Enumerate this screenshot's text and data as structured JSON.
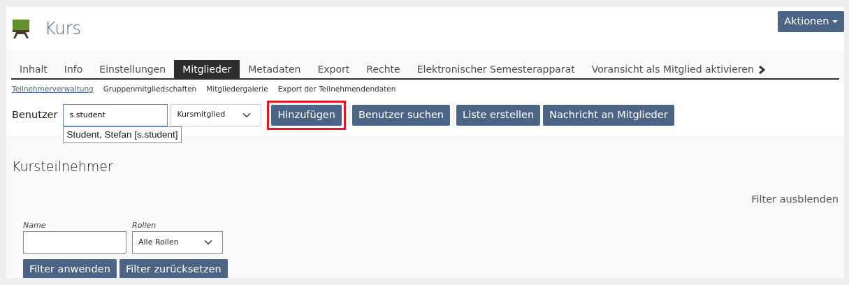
{
  "header": {
    "title": "Kurs",
    "actions_button": "Aktionen"
  },
  "tabs": [
    {
      "label": "Inhalt",
      "selected": false
    },
    {
      "label": "Info",
      "selected": false
    },
    {
      "label": "Einstellungen",
      "selected": false
    },
    {
      "label": "Mitglieder",
      "selected": true
    },
    {
      "label": "Metadaten",
      "selected": false
    },
    {
      "label": "Export",
      "selected": false
    },
    {
      "label": "Rechte",
      "selected": false
    },
    {
      "label": "Elektronischer Semesterapparat",
      "selected": false
    },
    {
      "label": "Voransicht als Mitglied aktivieren",
      "selected": false
    }
  ],
  "subtabs": [
    {
      "label": "Teilnehmerverwaltung",
      "selected": true
    },
    {
      "label": "Gruppenmitgliedschaften",
      "selected": false
    },
    {
      "label": "Mitgliedergalerie",
      "selected": false
    },
    {
      "label": "Export der Teilnehmendendaten",
      "selected": false
    }
  ],
  "add_user": {
    "label": "Benutzer",
    "value": "s.student",
    "suggestion": "Student, Stefan [s.student]",
    "role": "Kursmitglied",
    "button_groups": [
      [
        {
          "label": "Hinzufügen",
          "highlighted": true
        }
      ],
      [
        {
          "label": "Benutzer suchen",
          "highlighted": false
        }
      ],
      [
        {
          "label": "Liste erstellen",
          "highlighted": false
        },
        {
          "label": "Nachricht an Mitglieder",
          "highlighted": false
        }
      ]
    ]
  },
  "members": {
    "title": "Kursteilnehmer",
    "filter_toggle": "Filter ausblenden",
    "filter": {
      "name_label": "Name",
      "roles_label": "Rollen",
      "roles_value": "Alle Rollen",
      "buttons": [
        "Filter anwenden",
        "Filter zurücksetzen"
      ]
    }
  }
}
